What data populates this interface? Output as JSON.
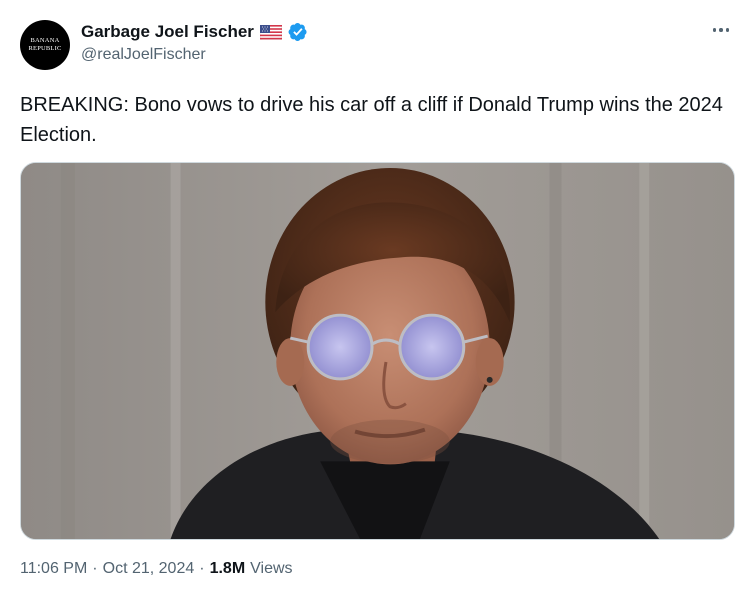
{
  "author": {
    "avatar_text": [
      "BANANA",
      "REPUBLIC"
    ],
    "display_name": "Garbage Joel Fischer",
    "handle": "@realJoelFischer",
    "flag_icon": "us-flag-icon",
    "verified_icon": "verified-badge-icon",
    "verified_color": "#1d9bf0"
  },
  "menu": {
    "icon": "more-icon"
  },
  "tweet": {
    "text": "BREAKING: Bono vows to drive his car off a cliff if Donald Trump wins the 2024 Election."
  },
  "meta": {
    "time": "11:06 PM",
    "separator": "·",
    "date": "Oct 21, 2024",
    "views_count": "1.8M",
    "views_label": "Views"
  }
}
